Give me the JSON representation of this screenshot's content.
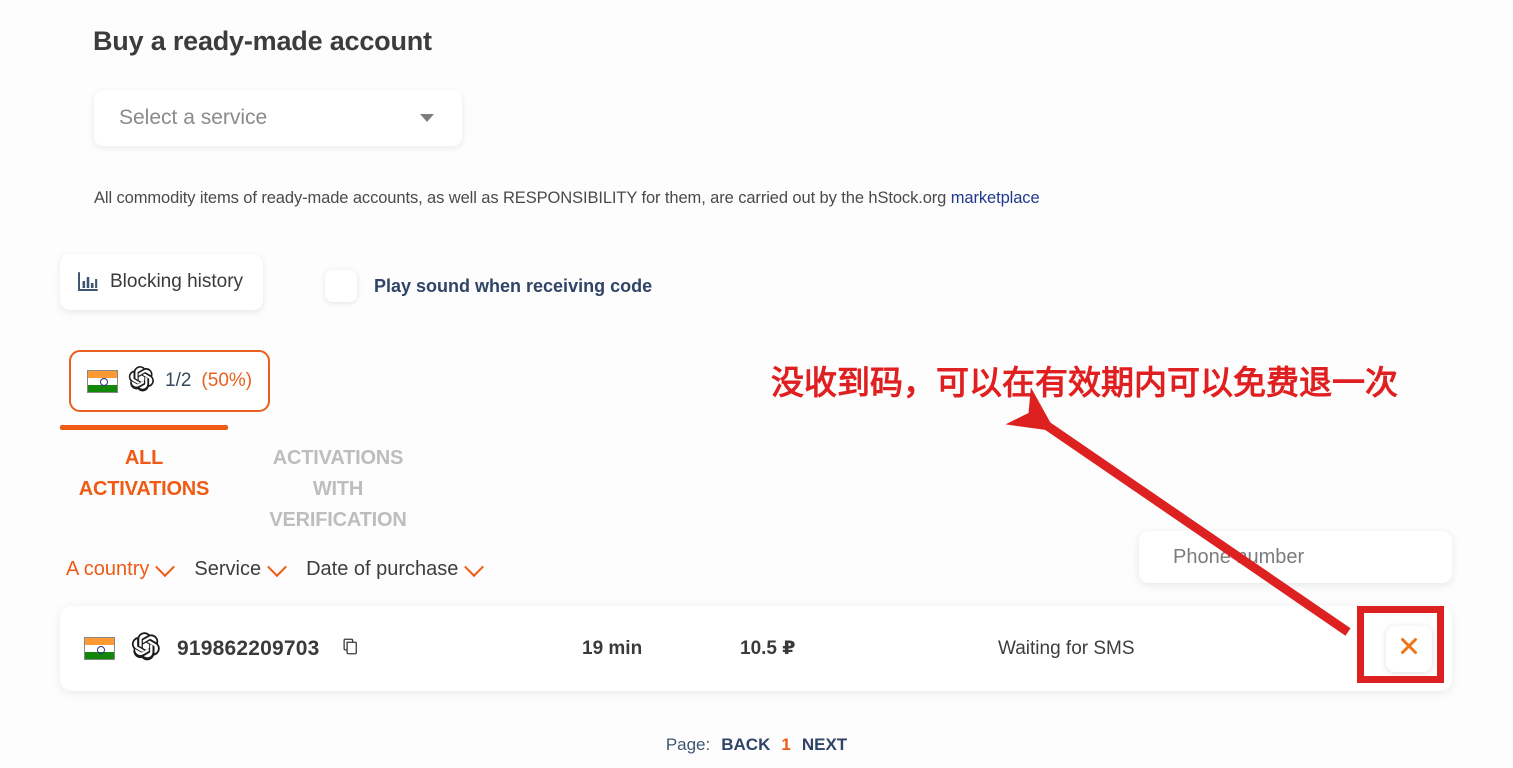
{
  "page": {
    "title": "Buy a ready-made account"
  },
  "service_select": {
    "placeholder": "Select a service",
    "icon": "chevron-down-icon"
  },
  "disclaimer": {
    "text": "All commodity items of ready-made accounts, as well as RESPONSIBILITY for them, are carried out by the hStock.org ",
    "link_text": "marketplace"
  },
  "toolbar": {
    "blocking_history_label": "Blocking history",
    "blocking_history_icon": "bar-chart-icon",
    "sound_label": "Play sound when receiving code",
    "sound_checked": false
  },
  "counter_badge": {
    "country_icon": "india-flag-icon",
    "service_icon": "openai-logo-icon",
    "ratio": "1/2",
    "percent": "(50%)"
  },
  "tabs": [
    {
      "line1": "ALL",
      "line2": "ACTIVATIONS",
      "active": true
    },
    {
      "line1": "ACTIVATIONS",
      "line2": "WITH VERIFICATION",
      "active": false
    }
  ],
  "filters": [
    {
      "label": "A country",
      "accent": true
    },
    {
      "label": "Service",
      "accent": false
    },
    {
      "label": "Date of purchase",
      "accent": false
    }
  ],
  "phone_search": {
    "placeholder": "Phone number",
    "value": ""
  },
  "table": {
    "rows": [
      {
        "country_icon": "india-flag-icon",
        "service_icon": "openai-logo-icon",
        "number": "919862209703",
        "copy_icon": "copy-icon",
        "time": "19 min",
        "price": "10.5 ₽",
        "status": "Waiting for SMS",
        "cancel_icon": "close-icon"
      }
    ]
  },
  "pagination": {
    "label": "Page:",
    "back": "BACK",
    "current": "1",
    "next": "NEXT"
  },
  "annotations": {
    "note_text": "没收到码，可以在有效期内可以免费退一次",
    "arrow_color": "#dd2020",
    "box_color": "#dd2020"
  },
  "colors": {
    "accent_orange": "#ef5a14",
    "navy": "#2f4466",
    "link_blue": "#21388c",
    "annotation_red": "#e02020"
  }
}
